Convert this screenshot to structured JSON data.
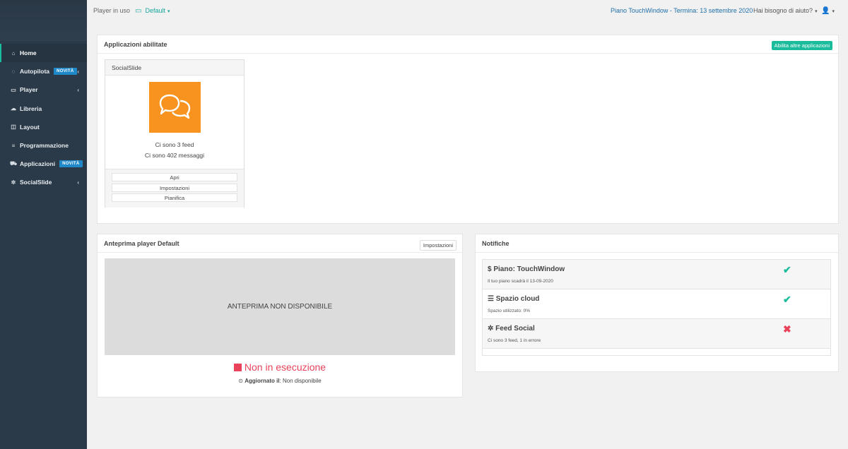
{
  "sidebar": {
    "items": [
      {
        "icon": "home-icon",
        "glyph": "⌂",
        "label": "Home",
        "active": true
      },
      {
        "icon": "spinner-icon",
        "glyph": "◌",
        "label": "Autopilota",
        "badge": "NOVITÀ",
        "chevron": "‹"
      },
      {
        "icon": "monitor-icon",
        "glyph": "▭",
        "label": "Player",
        "chevron": "‹"
      },
      {
        "icon": "cloud-icon",
        "glyph": "☁",
        "label": "Libreria"
      },
      {
        "icon": "layout-icon",
        "glyph": "◫",
        "label": "Layout"
      },
      {
        "icon": "list-icon",
        "glyph": "≡",
        "label": "Programmazione"
      },
      {
        "icon": "cart-icon",
        "glyph": "⛟",
        "label": "Applicazioni",
        "badge": "NOVITÀ"
      },
      {
        "icon": "pinwheel-icon",
        "glyph": "✲",
        "label": "SocialSlide",
        "chevron": "‹"
      }
    ]
  },
  "topbar": {
    "player_in_uso": "Player in uso",
    "player_name": "Default",
    "plan": "Piano TouchWindow - Termina: 13 settembre 2020",
    "help": "Hai bisogno di aiuto?"
  },
  "apps_panel": {
    "title": "Applicazioni abilitate",
    "enable_more": "Abilita altre applicazioni",
    "card": {
      "name": "SocialSlide",
      "feeds": "Ci sono 3 feed",
      "messages": "Ci sono 402 messaggi",
      "buttons": [
        "Apri",
        "Impostazioni",
        "Pianifica"
      ],
      "logo_color": "#f7931e"
    }
  },
  "preview_panel": {
    "title": "Anteprima player Default",
    "settings": "Impostazioni",
    "unavailable": "ANTEPRIMA NON DISPONIBILE",
    "status": "Non in esecuzione",
    "updated_label": "Aggiornato il",
    "updated_value": ": Non disponibile"
  },
  "notifications_panel": {
    "title": "Notifiche",
    "items": [
      {
        "glyph": "$",
        "title": "Piano: TouchWindow",
        "sub": "Il tuo piano scadrà il 13-09-2020",
        "status": "ok"
      },
      {
        "glyph": "☰",
        "title": "Spazio cloud",
        "sub": "Spazio utilizzato: 0%",
        "status": "ok"
      },
      {
        "glyph": "✲",
        "title": "Feed Social",
        "sub": "Ci sono 3 feed, 1 in errore",
        "status": "error"
      }
    ]
  },
  "colors": {
    "accent": "#1abc9c",
    "sidebar": "#2b3a48",
    "error": "#e8435a",
    "link": "#1f6fa8"
  }
}
